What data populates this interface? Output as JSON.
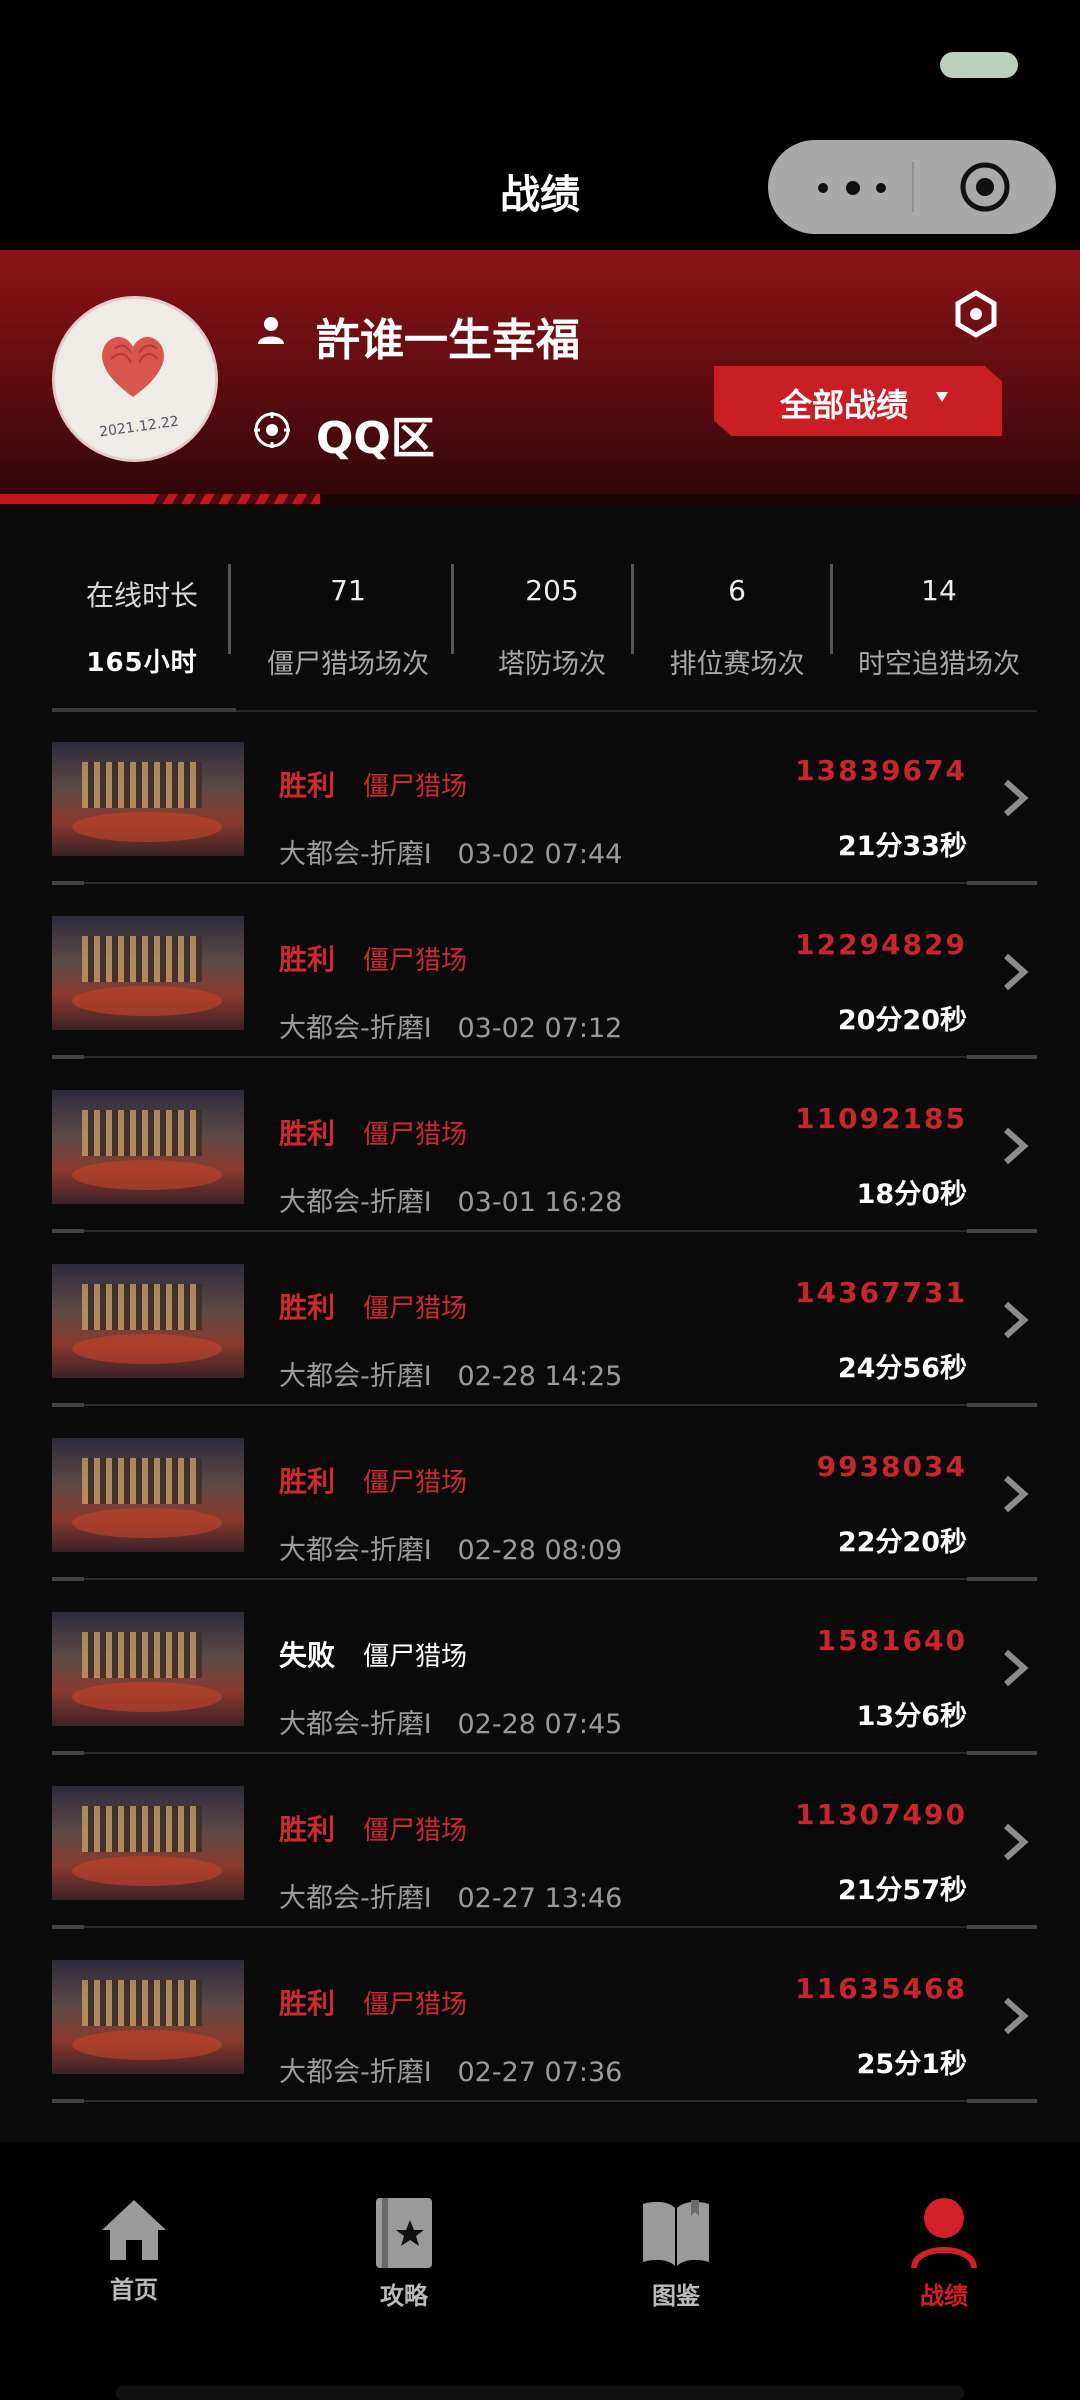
{
  "nav": {
    "title": "战绩"
  },
  "profile": {
    "username": "許谁一生幸福",
    "zone": "QQ区",
    "avatar_note": "2021.12.22",
    "filter_label": "全部战绩"
  },
  "stats": [
    {
      "value": "在线时长",
      "label": "165小时"
    },
    {
      "value": "71",
      "label": "僵尸猎场场次"
    },
    {
      "value": "205",
      "label": "塔防场次"
    },
    {
      "value": "6",
      "label": "排位赛场次"
    },
    {
      "value": "14",
      "label": "时空追猎场次"
    }
  ],
  "matches": [
    {
      "result": "胜利",
      "mode": "僵尸猎场",
      "map": "大都会-折磨I",
      "time": "03-02 07:44",
      "score": "13839674",
      "duration": "21分33秒"
    },
    {
      "result": "胜利",
      "mode": "僵尸猎场",
      "map": "大都会-折磨I",
      "time": "03-02 07:12",
      "score": "12294829",
      "duration": "20分20秒"
    },
    {
      "result": "胜利",
      "mode": "僵尸猎场",
      "map": "大都会-折磨I",
      "time": "03-01 16:28",
      "score": "11092185",
      "duration": "18分0秒"
    },
    {
      "result": "胜利",
      "mode": "僵尸猎场",
      "map": "大都会-折磨I",
      "time": "02-28 14:25",
      "score": "14367731",
      "duration": "24分56秒"
    },
    {
      "result": "胜利",
      "mode": "僵尸猎场",
      "map": "大都会-折磨I",
      "time": "02-28 08:09",
      "score": "9938034",
      "duration": "22分20秒"
    },
    {
      "result": "失败",
      "mode": "僵尸猎场",
      "map": "大都会-折磨I",
      "time": "02-28 07:45",
      "score": "1581640",
      "duration": "13分6秒"
    },
    {
      "result": "胜利",
      "mode": "僵尸猎场",
      "map": "大都会-折磨I",
      "time": "02-27 13:46",
      "score": "11307490",
      "duration": "21分57秒"
    },
    {
      "result": "胜利",
      "mode": "僵尸猎场",
      "map": "大都会-折磨I",
      "time": "02-27 07:36",
      "score": "11635468",
      "duration": "25分1秒"
    }
  ],
  "tabs": [
    {
      "label": "首页",
      "icon": "home-icon"
    },
    {
      "label": "攻略",
      "icon": "guide-book-icon"
    },
    {
      "label": "图鉴",
      "icon": "open-book-icon"
    },
    {
      "label": "战绩",
      "icon": "profile-icon",
      "active": true
    }
  ],
  "colors": {
    "accent": "#c91e23",
    "win": "#cc2a2f",
    "loss": "#ffffff",
    "background": "#0b0b0b"
  }
}
